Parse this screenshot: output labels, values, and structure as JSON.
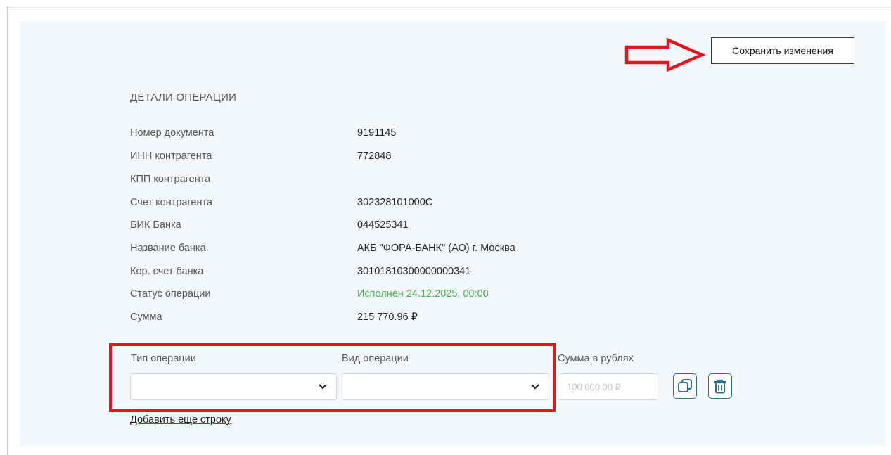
{
  "toolbar": {
    "save_label": "Сохранить изменения"
  },
  "details": {
    "title": "ДЕТАЛИ ОПЕРАЦИИ",
    "rows": [
      {
        "label": "Номер документа",
        "value": "9191145"
      },
      {
        "label": "ИНН контрагента",
        "value": "772848"
      },
      {
        "label": "КПП контрагента",
        "value": ""
      },
      {
        "label": "Счет контрагента",
        "value": "302328101000C"
      },
      {
        "label": "БИК Банка",
        "value": "044525341"
      },
      {
        "label": "Название банка",
        "value": "АКБ \"ФОРА-БАНК\" (АО) г. Москва"
      },
      {
        "label": "Кор. счет банка",
        "value": "30101810300000000341"
      },
      {
        "label": "Статус операции",
        "value": "Исполнен 24.12.2025, 00:00"
      },
      {
        "label": "Сумма",
        "value": "215 770.96 ₽"
      }
    ]
  },
  "operation_line": {
    "type_label": "Тип операции",
    "type_value": "",
    "kind_label": "Вид операции",
    "kind_value": "",
    "amount_label": "Сумма в рублях",
    "amount_placeholder": "100 000.00 ₽"
  },
  "add_row_label": "Добавить еще строку",
  "colors": {
    "accent_red": "#e3161e",
    "status_green": "#48b04d",
    "icon_blue": "#2a6d91",
    "card_bg": "#f3f8fc"
  },
  "icons": {
    "arrow": "right-arrow-outline-icon",
    "copy": "copy-icon",
    "delete": "trash-icon",
    "dropdown": "chevron-down-icon"
  }
}
